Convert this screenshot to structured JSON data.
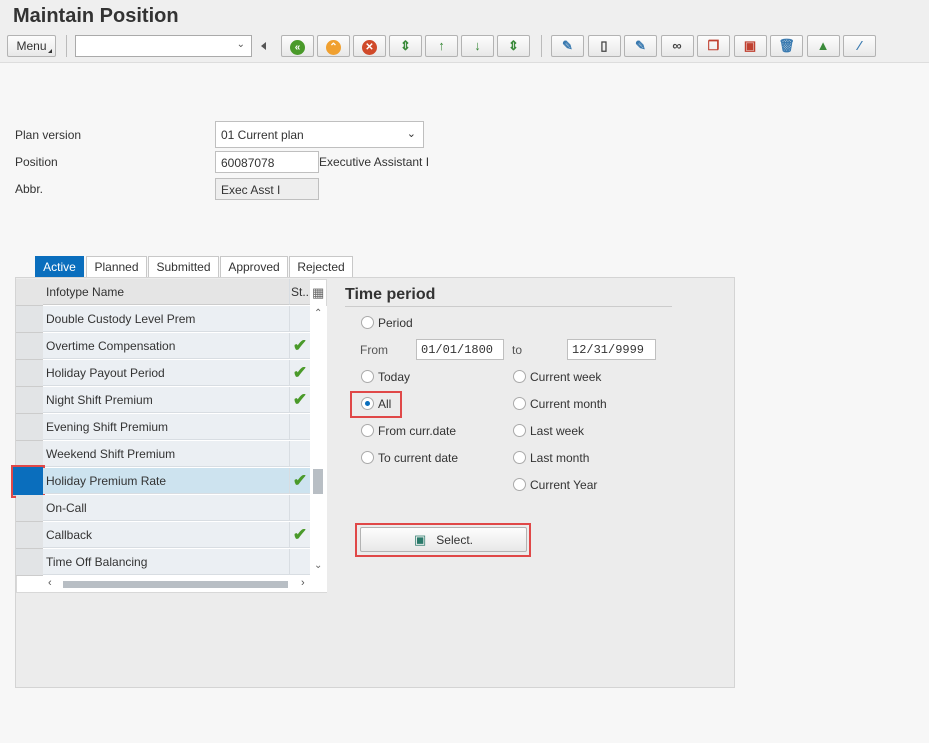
{
  "title": "Maintain Position",
  "toolbar": {
    "menu_label": "Menu",
    "command_value": "",
    "icons": [
      "back-icon",
      "exit-icon",
      "cancel-icon",
      "first-page-icon",
      "previous-page-icon",
      "next-page-icon",
      "last-page-icon",
      "overview-icon",
      "create-icon",
      "change-icon",
      "display-icon",
      "copy-icon",
      "check-icon",
      "delete-icon",
      "landscape-icon",
      "wand-icon"
    ]
  },
  "form": {
    "plan_version_label": "Plan version",
    "plan_version_value": "01 Current plan",
    "position_label": "Position",
    "position_value": "60087078",
    "position_text": "Executive Assistant I",
    "abbr_label": "Abbr.",
    "abbr_value": "Exec Asst I"
  },
  "tabs": [
    "Active",
    "Planned",
    "Submitted",
    "Approved",
    "Rejected"
  ],
  "table": {
    "col_name": "Infotype Name",
    "col_status": "St..",
    "rows": [
      {
        "name": "Double Custody Level Prem",
        "status": ""
      },
      {
        "name": "Overtime Compensation",
        "status": "✔"
      },
      {
        "name": "Holiday Payout Period",
        "status": "✔"
      },
      {
        "name": "Night Shift Premium",
        "status": "✔"
      },
      {
        "name": "Evening Shift Premium",
        "status": ""
      },
      {
        "name": "Weekend Shift Premium",
        "status": ""
      },
      {
        "name": "Holiday Premium Rate",
        "status": "✔",
        "selected": true
      },
      {
        "name": "On-Call",
        "status": ""
      },
      {
        "name": "Callback",
        "status": "✔"
      },
      {
        "name": "Time Off Balancing",
        "status": ""
      }
    ]
  },
  "time_period": {
    "title": "Time period",
    "period": "Period",
    "from_label": "From",
    "from_value": "01/01/1800",
    "to_label": "to",
    "to_value": "12/31/9999",
    "left_options": [
      "Today",
      "All",
      "From curr.date",
      "To current date"
    ],
    "right_options": [
      "Current week",
      "Current month",
      "Last week",
      "Last month",
      "Current Year"
    ],
    "selected": "All",
    "select_button": "Select."
  }
}
